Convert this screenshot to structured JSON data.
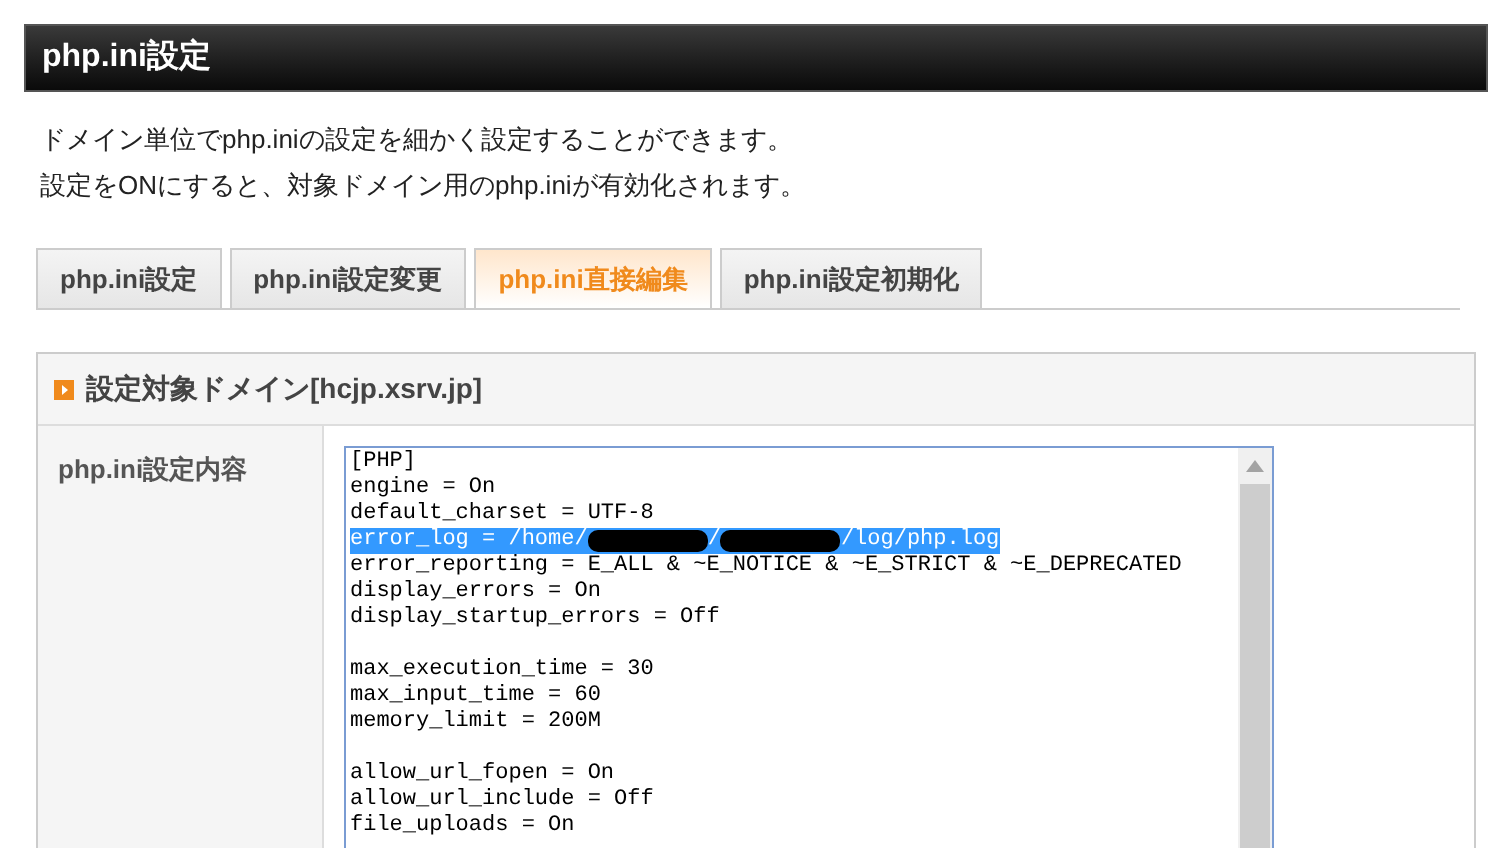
{
  "header": {
    "title": "php.ini設定"
  },
  "description": [
    "ドメイン単位でphp.iniの設定を細かく設定することができます。",
    "設定をONにすると、対象ドメイン用のphp.iniが有効化されます。"
  ],
  "tabs": [
    {
      "label": "php.ini設定",
      "selected": false
    },
    {
      "label": "php.ini設定変更",
      "selected": false
    },
    {
      "label": "php.ini直接編集",
      "selected": true
    },
    {
      "label": "php.ini設定初期化",
      "selected": false
    }
  ],
  "panel": {
    "title": "設定対象ドメイン[hcjp.xsrv.jp]",
    "field_label": "php.ini設定内容",
    "editor_lines": [
      {
        "selected": false,
        "segments": [
          {
            "kind": "text",
            "text": "[PHP]"
          }
        ]
      },
      {
        "selected": false,
        "segments": [
          {
            "kind": "text",
            "text": "engine = On"
          }
        ]
      },
      {
        "selected": false,
        "segments": [
          {
            "kind": "text",
            "text": "default_charset = UTF-8"
          }
        ]
      },
      {
        "selected": true,
        "segments": [
          {
            "kind": "text",
            "text": "error_log = /home/"
          },
          {
            "kind": "redaction"
          },
          {
            "kind": "text",
            "text": "/"
          },
          {
            "kind": "redaction"
          },
          {
            "kind": "text",
            "text": "/log/php.log"
          }
        ]
      },
      {
        "selected": false,
        "segments": [
          {
            "kind": "text",
            "text": "error_reporting = E_ALL & ~E_NOTICE & ~E_STRICT & ~E_DEPRECATED"
          }
        ]
      },
      {
        "selected": false,
        "segments": [
          {
            "kind": "text",
            "text": "display_errors = On"
          }
        ]
      },
      {
        "selected": false,
        "segments": [
          {
            "kind": "text",
            "text": "display_startup_errors = Off"
          }
        ]
      },
      {
        "selected": false
      },
      {
        "selected": false,
        "segments": [
          {
            "kind": "text",
            "text": "max_execution_time = 30"
          }
        ]
      },
      {
        "selected": false,
        "segments": [
          {
            "kind": "text",
            "text": "max_input_time = 60"
          }
        ]
      },
      {
        "selected": false,
        "segments": [
          {
            "kind": "text",
            "text": "memory_limit = 200M"
          }
        ]
      },
      {
        "selected": false
      },
      {
        "selected": false,
        "segments": [
          {
            "kind": "text",
            "text": "allow_url_fopen = On"
          }
        ]
      },
      {
        "selected": false,
        "segments": [
          {
            "kind": "text",
            "text": "allow_url_include = Off"
          }
        ]
      },
      {
        "selected": false,
        "segments": [
          {
            "kind": "text",
            "text": "file_uploads = On"
          }
        ]
      }
    ]
  }
}
